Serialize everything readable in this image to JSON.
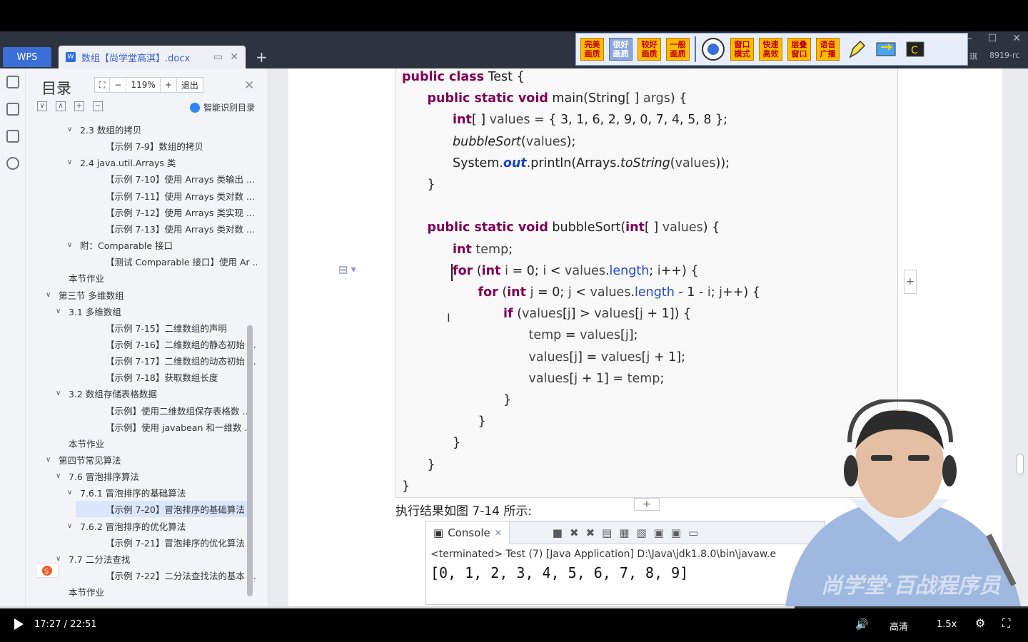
{
  "wps": {
    "logo": "WPS",
    "tab_name": "数组【尚学堂高淇】.docx",
    "version": "8919-rc",
    "version_prefix": "琪"
  },
  "quality_bar": {
    "buttons": [
      "完美画质",
      "很好画质",
      "较好画质",
      "一般画质",
      "窗口模式",
      "快速高效",
      "层叠窗口",
      "语音广播"
    ]
  },
  "toc": {
    "title": "目录",
    "zoom": "119%",
    "exit": "退出",
    "smart_label": "智能识别目录",
    "items": [
      {
        "level": 2,
        "chevron": "∨",
        "text": "2.3  数组的拷贝"
      },
      {
        "level": 3,
        "chevron": "",
        "text": "【示例 7-9】数组的拷贝"
      },
      {
        "level": 2,
        "chevron": "∨",
        "text": "2.4 java.util.Arrays 类"
      },
      {
        "level": 3,
        "chevron": "",
        "text": "【示例 7-10】使用 Arrays 类输出 ..."
      },
      {
        "level": 3,
        "chevron": "",
        "text": "【示例 7-11】使用 Arrays 类对数 ..."
      },
      {
        "level": 3,
        "chevron": "",
        "text": "【示例 7-12】使用 Arrays 类实现 ..."
      },
      {
        "level": 3,
        "chevron": "",
        "text": "【示例 7-13】使用 Arrays 类对数 ..."
      },
      {
        "level": 2,
        "chevron": "∨",
        "text": "附：Comparable 接口"
      },
      {
        "level": 3,
        "chevron": "",
        "text": "【测试 Comparable 接口】使用 Ar ..."
      },
      {
        "level": 1,
        "chevron": "",
        "text": "本节作业"
      },
      {
        "level": 0,
        "chevron": "∨",
        "text": "第三节  多维数组"
      },
      {
        "level": 1,
        "chevron": "∨",
        "text": "3.1  多维数组"
      },
      {
        "level": 3,
        "chevron": "",
        "text": "【示例 7-15】二维数组的声明"
      },
      {
        "level": 3,
        "chevron": "",
        "text": "【示例 7-16】二维数组的静态初始 ..."
      },
      {
        "level": 3,
        "chevron": "",
        "text": "【示例 7-17】二维数组的动态初始 ..."
      },
      {
        "level": 3,
        "chevron": "",
        "text": "【示例 7-18】获取数组长度"
      },
      {
        "level": 1,
        "chevron": "∨",
        "text": "3.2  数组存储表格数据"
      },
      {
        "level": 3,
        "chevron": "",
        "text": "【示例】使用二维数组保存表格数 ..."
      },
      {
        "level": 3,
        "chevron": "",
        "text": "【示例】使用 javabean 和一维数 ..."
      },
      {
        "level": 1,
        "chevron": "",
        "text": "本节作业"
      },
      {
        "level": 0,
        "chevron": "∨",
        "text": "第四节常见算法"
      },
      {
        "level": 1,
        "chevron": "∨",
        "text": "7.6  冒泡排序算法"
      },
      {
        "level": 2,
        "chevron": "∨",
        "text": "7.6.1  冒泡排序的基础算法"
      },
      {
        "level": 3,
        "chevron": "",
        "text": "【示例 7-20】冒泡排序的基础算法",
        "active": true
      },
      {
        "level": 2,
        "chevron": "∨",
        "text": "7.6.2  冒泡排序的优化算法"
      },
      {
        "level": 3,
        "chevron": "",
        "text": "【示例 7-21】冒泡排序的优化算法"
      },
      {
        "level": 1,
        "chevron": "∨",
        "text": "7.7  二分法查找"
      },
      {
        "level": 3,
        "chevron": "",
        "text": "【示例 7-22】二分法查找法的基本 ..."
      },
      {
        "level": 1,
        "chevron": "",
        "text": "本节作业"
      }
    ]
  },
  "code": {
    "lines": [
      {
        "indent": 0,
        "html": "<span class='kw'>public class</span> Test {"
      },
      {
        "indent": 1,
        "html": "<span class='kw'>public static void</span> main(String[ ] <span class='var'>args</span>) {"
      },
      {
        "indent": 2,
        "html": "<span class='kw'>int</span>[ ] <span class='var'>values</span> = { 3, 1, 6, 2, 9, 0, 7, 4, 5, 8 };"
      },
      {
        "indent": 2,
        "html": "<span class='it'>bubbleSort</span>(<span class='var'>values</span>);"
      },
      {
        "indent": 2,
        "html": "System.<span class='itb'>out</span>.println(Arrays.<span class='it'>toString</span>(<span class='var'>values</span>));"
      },
      {
        "indent": 1,
        "html": "}"
      },
      {
        "indent": 0,
        "html": ""
      },
      {
        "indent": 1,
        "html": "<span class='kw'>public static void</span> bubbleSort(<span class='kw'>int</span>[ ] <span class='var'>values</span>) {"
      },
      {
        "indent": 2,
        "html": "<span class='kw'>int</span> <span class='var'>temp</span>;"
      },
      {
        "indent": 2,
        "html": "<span class='kw'>for</span> (<span class='kw'>int</span> <span class='var'>i</span> = 0; <span class='var'>i</span> &lt; <span class='var'>values</span>.<span class='fld'>length</span>; <span class='var'>i</span>++) {"
      },
      {
        "indent": 3,
        "html": "<span class='kw'>for</span> (<span class='kw'>int</span> <span class='var'>j</span> = 0; <span class='var'>j</span> &lt; <span class='var'>values</span>.<span class='fld'>length</span> - 1 - <span class='var'>i</span>; <span class='var'>j</span>++) {"
      },
      {
        "indent": 4,
        "html": "<span class='kw'>if</span> (<span class='var'>values</span>[<span class='var'>j</span>] &gt; <span class='var'>values</span>[<span class='var'>j</span> + 1]) {"
      },
      {
        "indent": 5,
        "html": "<span class='var'>temp</span> = <span class='var'>values</span>[<span class='var'>j</span>];"
      },
      {
        "indent": 5,
        "html": "<span class='var'>values</span>[<span class='var'>j</span>] = <span class='var'>values</span>[<span class='var'>j</span> + 1];"
      },
      {
        "indent": 5,
        "html": "<span class='var'>values</span>[<span class='var'>j</span> + 1] = <span class='var'>temp</span>;"
      },
      {
        "indent": 4,
        "html": "}"
      },
      {
        "indent": 3,
        "html": "}"
      },
      {
        "indent": 2,
        "html": "}"
      },
      {
        "indent": 1,
        "html": "}"
      },
      {
        "indent": 0,
        "html": "}"
      }
    ]
  },
  "result_label": "执行结果如图 7-14 所示:",
  "console": {
    "tab": "Console",
    "terminated": "<terminated> Test (7) [Java Application] D:\\Java\\jdk1.8.0\\bin\\javaw.e",
    "output": "[0, 1, 2, 3, 4, 5, 6, 7, 8, 9]"
  },
  "watermark": "尚学堂·百战程序员",
  "player": {
    "time": "17:27 / 22:51",
    "progress": 0.7726,
    "quality": "高清",
    "speed": "1.5x"
  }
}
